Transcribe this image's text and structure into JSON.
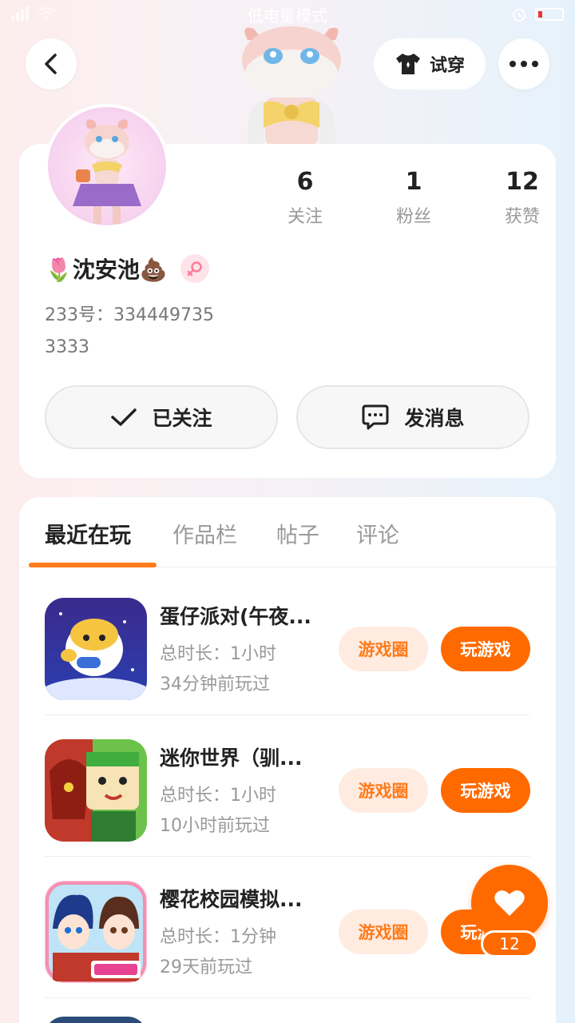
{
  "status_bar": {
    "mode_text": "低电量模式"
  },
  "header": {
    "try_on_label": "试穿"
  },
  "profile": {
    "name": "🌷沈安池💩",
    "uid_text": "233号：334449735",
    "bio": "3333",
    "stats": [
      {
        "value": "6",
        "label": "关注"
      },
      {
        "value": "1",
        "label": "粉丝"
      },
      {
        "value": "12",
        "label": "获赞"
      }
    ],
    "follow_label": "已关注",
    "message_label": "发消息"
  },
  "tabs": [
    {
      "label": "最近在玩",
      "active": true
    },
    {
      "label": "作品栏",
      "active": false
    },
    {
      "label": "帖子",
      "active": false
    },
    {
      "label": "评论",
      "active": false
    }
  ],
  "games": [
    {
      "name": "蛋仔派对(午夜...",
      "duration": "总时长：1小时",
      "last_played": "34分钟前玩过",
      "circle_label": "游戏圈",
      "play_label": "玩游戏",
      "icon_name": "eggy-party-game-icon"
    },
    {
      "name": "迷你世界（驯...",
      "duration": "总时长：1小时",
      "last_played": "10小时前玩过",
      "circle_label": "游戏圈",
      "play_label": "玩游戏",
      "icon_name": "mini-world-game-icon"
    },
    {
      "name": "樱花校园模拟...",
      "duration": "总时长：1分钟",
      "last_played": "29天前玩过",
      "circle_label": "游戏圈",
      "play_label": "玩游戏",
      "icon_name": "sakura-school-game-icon"
    }
  ],
  "like_fab": {
    "count": "12"
  },
  "colors": {
    "accent": "#ff6a00",
    "accent_light": "#ffebe0"
  }
}
